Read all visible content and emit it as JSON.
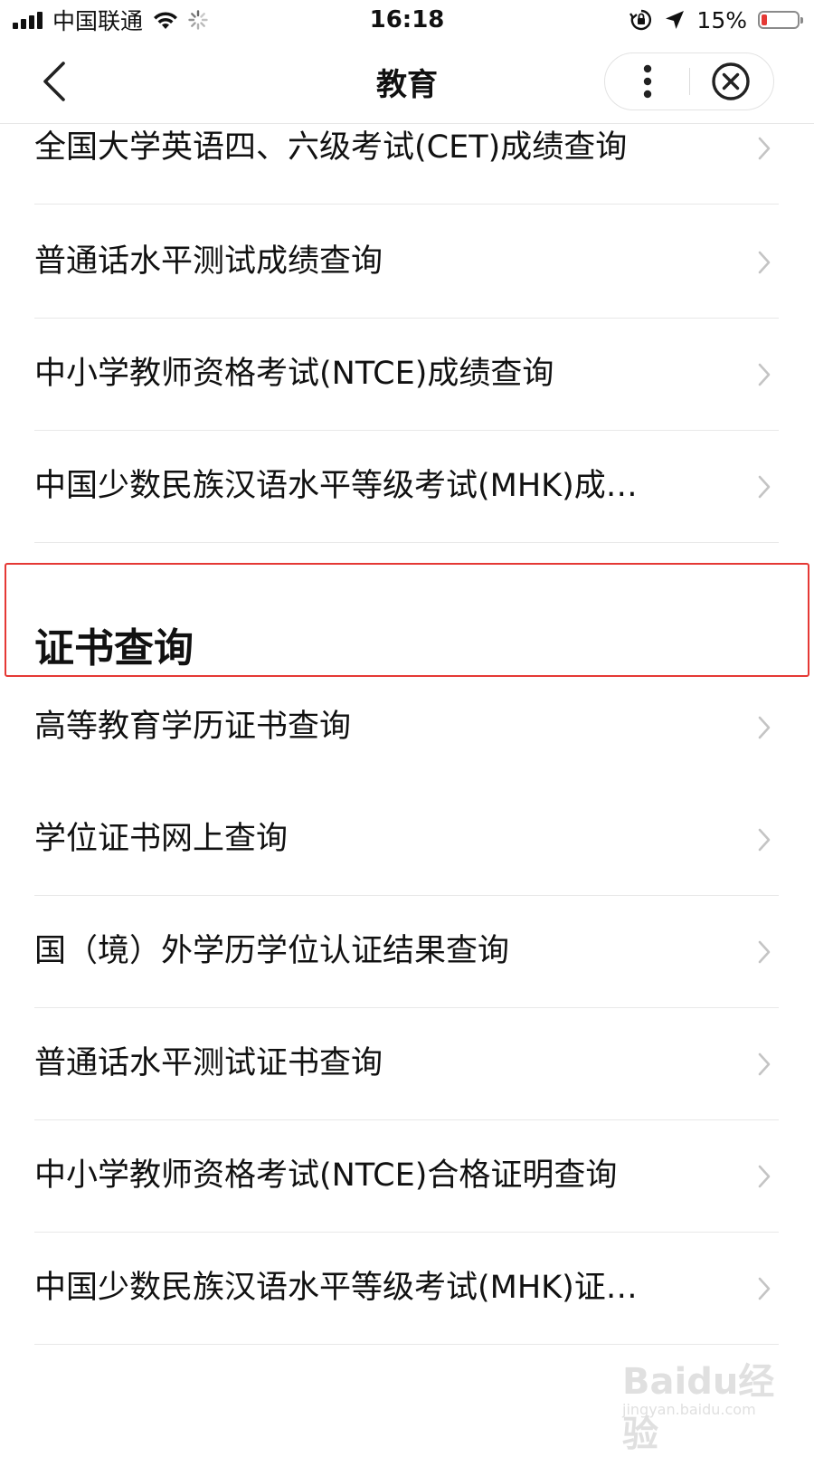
{
  "status_bar": {
    "carrier": "中国联通",
    "time": "16:18",
    "battery": "15%",
    "battery_level": 0.15,
    "icons": [
      "signal-icon",
      "wifi-icon",
      "loading-icon",
      "rotation-lock-icon",
      "location-arrow-icon",
      "battery-icon"
    ]
  },
  "nav": {
    "title": "教育",
    "back_icon": "back-arrow-icon",
    "more_icon": "more-vertical-icon",
    "close_icon": "close-circle-icon"
  },
  "score_items": [
    "全国大学英语四、六级考试(CET)成绩查询",
    "普通话水平测试成绩查询",
    "中小学教师资格考试(NTCE)成绩查询",
    "中国少数民族汉语水平等级考试(MHK)成…"
  ],
  "certificate_section": {
    "title": "证书查询",
    "items": [
      "高等教育学历证书查询",
      "学位证书网上查询",
      "国（境）外学历学位认证结果查询",
      "普通话水平测试证书查询",
      "中小学教师资格考试(NTCE)合格证明查询",
      "中国少数民族汉语水平等级考试(MHK)证…"
    ],
    "highlighted_index": 0,
    "highlight_color": "#e53935"
  },
  "watermark": {
    "brand": "Baidu经验",
    "url": "jingyan.baidu.com"
  }
}
